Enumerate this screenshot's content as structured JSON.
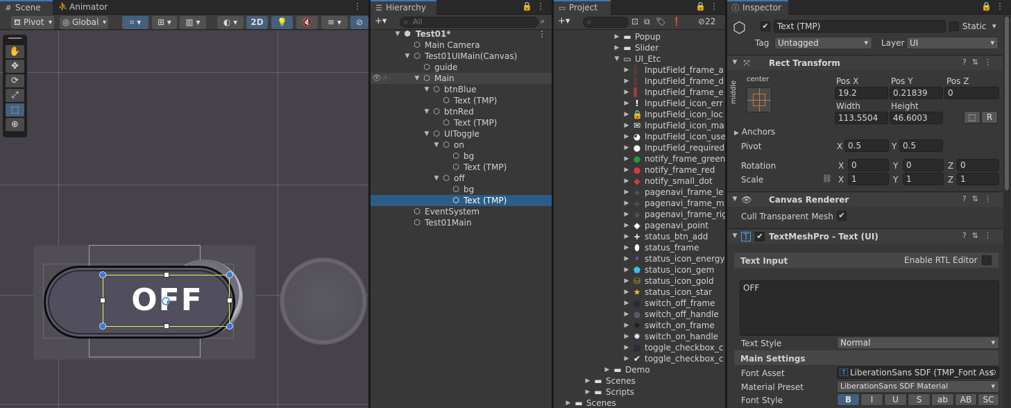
{
  "scene": {
    "tabs": [
      {
        "label": "Scene"
      },
      {
        "label": "Animator"
      }
    ],
    "toolbar": {
      "pivot": "Pivot",
      "global": "Global",
      "mode2d": "2D"
    },
    "toggle_label": "OFF"
  },
  "hierarchy": {
    "tab": "Hierarchy",
    "search_placeholder": "All",
    "items": [
      {
        "label": "Test01*"
      },
      {
        "label": "Main Camera"
      },
      {
        "label": "Test01UIMain(Canvas)"
      },
      {
        "label": "guide"
      },
      {
        "label": "Main"
      },
      {
        "label": "btnBlue"
      },
      {
        "label": "Text (TMP)"
      },
      {
        "label": "btnRed"
      },
      {
        "label": "Text (TMP)"
      },
      {
        "label": "UIToggle"
      },
      {
        "label": "on"
      },
      {
        "label": "bg"
      },
      {
        "label": "Text (TMP)"
      },
      {
        "label": "off"
      },
      {
        "label": "bg"
      },
      {
        "label": "Text (TMP)"
      },
      {
        "label": "EventSystem"
      },
      {
        "label": "Test01Main"
      }
    ]
  },
  "project": {
    "tab": "Project",
    "hidden_count": "22",
    "items": [
      {
        "label": "Popup"
      },
      {
        "label": "Slider"
      },
      {
        "label": "UI_Etc"
      },
      {
        "label": "InputField_frame_a"
      },
      {
        "label": "InputField_frame_d"
      },
      {
        "label": "InputField_frame_e"
      },
      {
        "label": "InputField_icon_err"
      },
      {
        "label": "InputField_icon_loc"
      },
      {
        "label": "InputField_icon_ma"
      },
      {
        "label": "InputField_icon_use"
      },
      {
        "label": "InputField_required"
      },
      {
        "label": "notify_frame_green"
      },
      {
        "label": "notify_frame_red"
      },
      {
        "label": "notify_small_dot"
      },
      {
        "label": "pagenavi_frame_le"
      },
      {
        "label": "pagenavi_frame_m"
      },
      {
        "label": "pagenavi_frame_rig"
      },
      {
        "label": "pagenavi_point"
      },
      {
        "label": "status_btn_add"
      },
      {
        "label": "status_frame"
      },
      {
        "label": "status_icon_energy"
      },
      {
        "label": "status_icon_gem"
      },
      {
        "label": "status_icon_gold"
      },
      {
        "label": "status_icon_star"
      },
      {
        "label": "switch_off_frame"
      },
      {
        "label": "switch_off_handle"
      },
      {
        "label": "switch_on_frame"
      },
      {
        "label": "switch_on_handle"
      },
      {
        "label": "toggle_checkbox_c"
      },
      {
        "label": "toggle_checkbox_c"
      },
      {
        "label": "Demo"
      },
      {
        "label": "Scenes"
      },
      {
        "label": "Scripts"
      },
      {
        "label": "Scenes"
      }
    ]
  },
  "inspector": {
    "tab": "Inspector",
    "object_name": "Text (TMP)",
    "static_label": "Static",
    "tag_label": "Tag",
    "tag_value": "Untagged",
    "layer_label": "Layer",
    "layer_value": "UI",
    "rect": {
      "title": "Rect Transform",
      "anchor_h": "center",
      "anchor_v": "middle",
      "posx_label": "Pos X",
      "posy_label": "Pos Y",
      "posz_label": "Pos Z",
      "posx": "19.2",
      "posy": "0.21839",
      "posz": "0",
      "width_label": "Width",
      "height_label": "Height",
      "width": "113.5504",
      "height": "46.6003",
      "r_button": "R",
      "anchors_label": "Anchors",
      "pivot_label": "Pivot",
      "pivot_x": "0.5",
      "pivot_y": "0.5",
      "rotation_label": "Rotation",
      "rot_x": "0",
      "rot_y": "0",
      "rot_z": "0",
      "scale_label": "Scale",
      "scale_x": "1",
      "scale_y": "1",
      "scale_z": "1",
      "x": "X",
      "y": "Y",
      "z": "Z"
    },
    "canvas_renderer": {
      "title": "Canvas Renderer",
      "cull_label": "Cull Transparent Mesh"
    },
    "tmp": {
      "title": "TextMeshPro - Text (UI)",
      "text_input_label": "Text Input",
      "rtl_label": "Enable RTL Editor",
      "text_value": "OFF",
      "text_style_label": "Text Style",
      "text_style_value": "Normal",
      "main_settings_label": "Main Settings",
      "font_asset_label": "Font Asset",
      "font_asset_value": "LiberationSans SDF (TMP_Font Ass",
      "material_preset_label": "Material Preset",
      "material_preset_value": "LiberationSans SDF Material",
      "font_style_label": "Font Style",
      "font_styles": [
        "B",
        "I",
        "U",
        "S",
        "ab",
        "AB",
        "SC"
      ]
    }
  }
}
